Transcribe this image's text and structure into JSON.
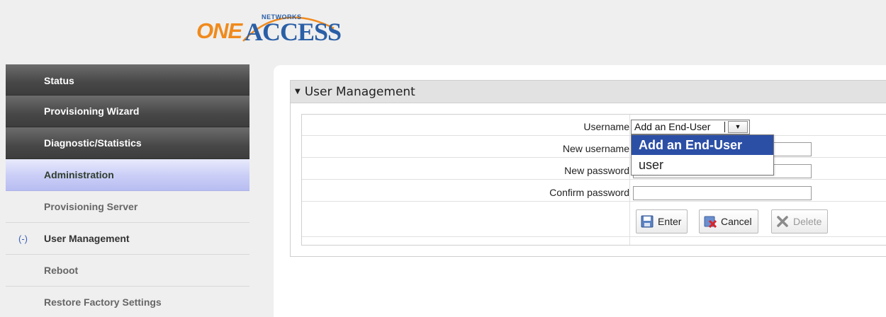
{
  "brand": {
    "logo_one": "ONE",
    "logo_access": "ACCESS",
    "logo_networks": "NETWORKS"
  },
  "sidebar": {
    "items": [
      {
        "label": "Status"
      },
      {
        "label": "Provisioning Wizard"
      },
      {
        "label": "Diagnostic/Statistics"
      },
      {
        "label": "Administration"
      },
      {
        "label": "Provisioning Server"
      },
      {
        "label": "User Management",
        "marker": "(-)"
      },
      {
        "label": "Reboot"
      },
      {
        "label": "Restore Factory Settings"
      }
    ]
  },
  "section": {
    "title": "User Management"
  },
  "form": {
    "username_label": "Username",
    "username_value": "Add an End-User",
    "new_username_label": "New username",
    "new_password_label": "New password",
    "confirm_password_label": "Confirm password",
    "dropdown_options": [
      "Add an End-User",
      "user"
    ]
  },
  "buttons": {
    "enter": "Enter",
    "cancel": "Cancel",
    "delete": "Delete"
  },
  "colors": {
    "accent_blue": "#2c4fa6",
    "logo_orange": "#f08a1c",
    "logo_blue": "#2a5fa6"
  }
}
